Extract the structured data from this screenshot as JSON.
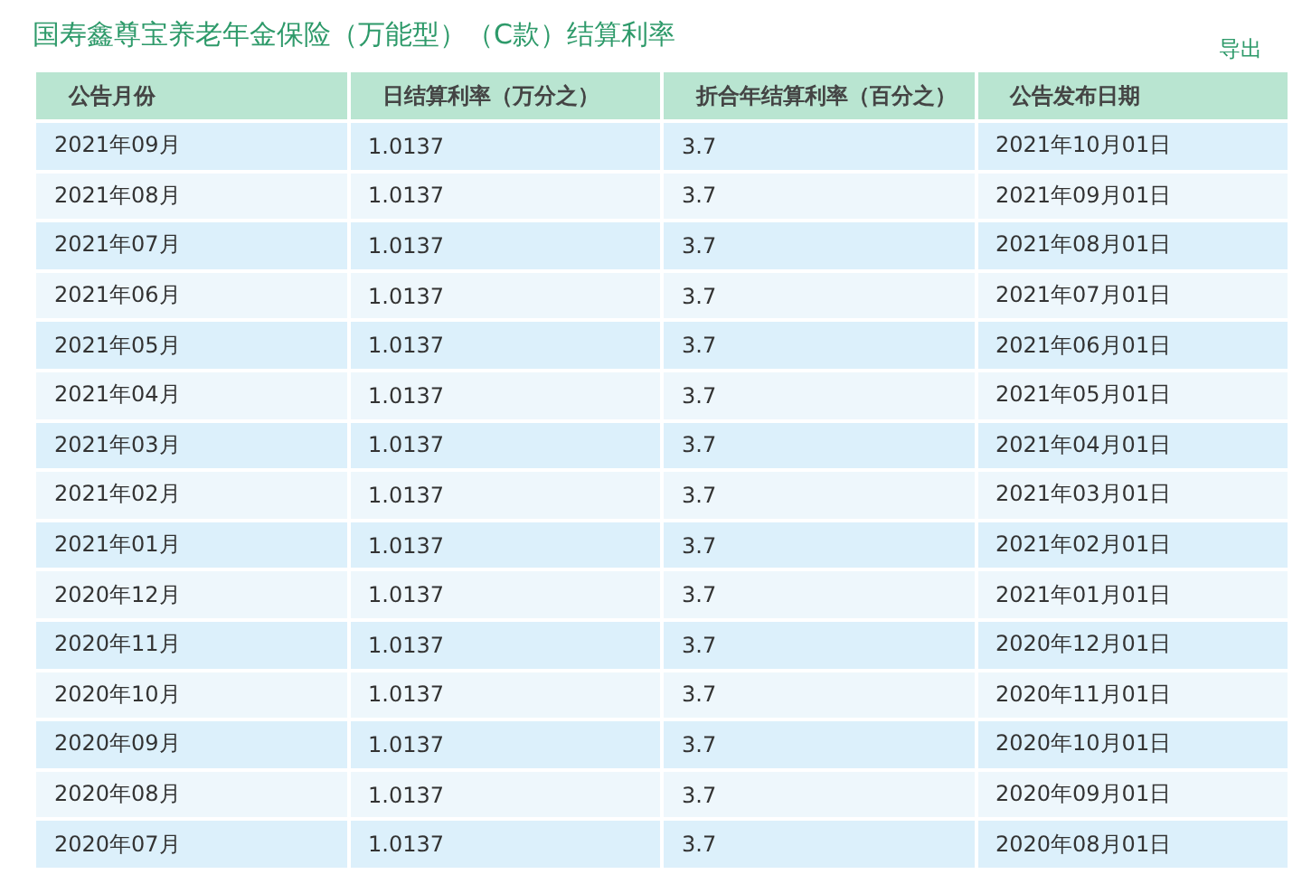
{
  "title": "国寿鑫尊宝养老年金保险（万能型）（C款）结算利率",
  "export_link": "导出",
  "table": {
    "columns": [
      "公告月份",
      "日结算利率（万分之）",
      "折合年结算利率（百分之）",
      "公告发布日期"
    ],
    "rows": [
      [
        "2021年09月",
        "1.0137",
        "3.7",
        "2021年10月01日"
      ],
      [
        "2021年08月",
        "1.0137",
        "3.7",
        "2021年09月01日"
      ],
      [
        "2021年07月",
        "1.0137",
        "3.7",
        "2021年08月01日"
      ],
      [
        "2021年06月",
        "1.0137",
        "3.7",
        "2021年07月01日"
      ],
      [
        "2021年05月",
        "1.0137",
        "3.7",
        "2021年06月01日"
      ],
      [
        "2021年04月",
        "1.0137",
        "3.7",
        "2021年05月01日"
      ],
      [
        "2021年03月",
        "1.0137",
        "3.7",
        "2021年04月01日"
      ],
      [
        "2021年02月",
        "1.0137",
        "3.7",
        "2021年03月01日"
      ],
      [
        "2021年01月",
        "1.0137",
        "3.7",
        "2021年02月01日"
      ],
      [
        "2020年12月",
        "1.0137",
        "3.7",
        "2021年01月01日"
      ],
      [
        "2020年11月",
        "1.0137",
        "3.7",
        "2020年12月01日"
      ],
      [
        "2020年10月",
        "1.0137",
        "3.7",
        "2020年11月01日"
      ],
      [
        "2020年09月",
        "1.0137",
        "3.7",
        "2020年10月01日"
      ],
      [
        "2020年08月",
        "1.0137",
        "3.7",
        "2020年09月01日"
      ],
      [
        "2020年07月",
        "1.0137",
        "3.7",
        "2020年08月01日"
      ]
    ]
  }
}
